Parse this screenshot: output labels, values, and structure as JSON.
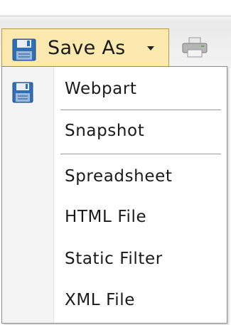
{
  "toolbar": {
    "save_as_label": "Save As",
    "icons": [
      "floppy-disk-icon",
      "chevron-down-icon",
      "printer-icon"
    ]
  },
  "menu": {
    "items": [
      {
        "label": "Webpart",
        "icon": "floppy-disk-icon"
      },
      {
        "label": "Snapshot"
      },
      {
        "label": "Spreadsheet"
      },
      {
        "label": "HTML File"
      },
      {
        "label": "Static Filter"
      },
      {
        "label": "XML File"
      }
    ]
  },
  "colors": {
    "button_highlight": "#fbe9b0",
    "button_border": "#b89a46",
    "menu_border": "#8c8c8c",
    "floppy_blue": "#2f6fb6"
  }
}
